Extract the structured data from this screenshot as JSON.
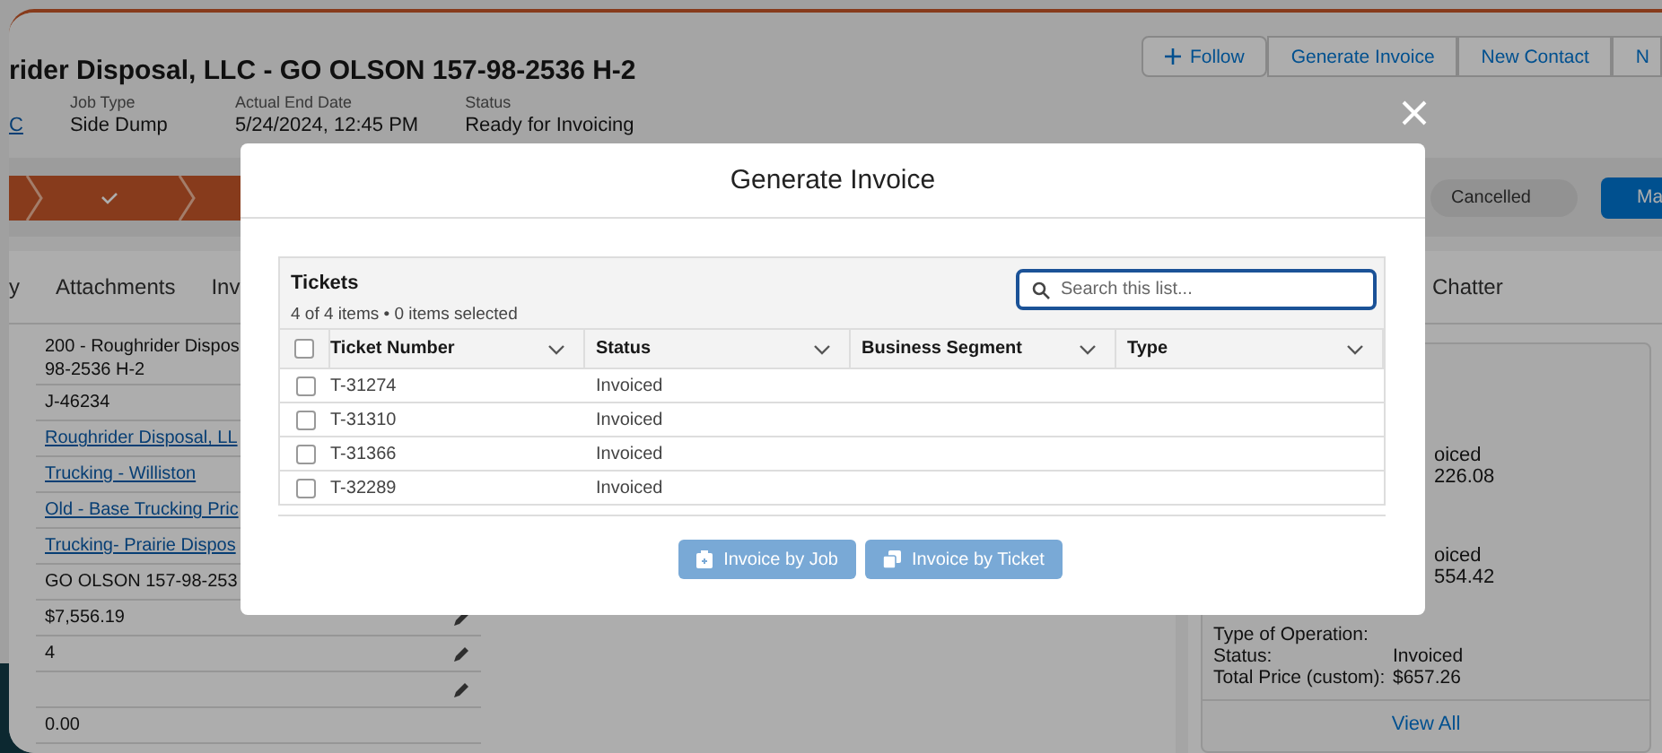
{
  "record": {
    "title": "rider Disposal, LLC - GO OLSON 157-98-2536 H-2",
    "actions": [
      {
        "label": "Follow"
      },
      {
        "label": "Generate Invoice"
      },
      {
        "label": "New Contact"
      },
      {
        "label": "N"
      }
    ]
  },
  "highlights": [
    {
      "value": "C",
      "kind": "link"
    },
    {
      "label": "Job Type",
      "value": "Side Dump",
      "kind": "text"
    },
    {
      "label": "Actual End Date",
      "value": "5/24/2024, 12:45 PM",
      "kind": "text"
    },
    {
      "label": "Status",
      "value": "Ready for Invoicing",
      "kind": "text"
    }
  ],
  "path": {
    "status_pill": "Cancelled",
    "mark_button": "Ma"
  },
  "tabs": [
    {
      "label": "y"
    },
    {
      "label": "Attachments"
    },
    {
      "label": "Inv"
    }
  ],
  "side_tabs": [
    {
      "label": "Chatter"
    }
  ],
  "details": [
    {
      "lines": [
        "200 - Roughrider Dispos",
        "98-2536 H-2"
      ],
      "kind": "text",
      "editable": false
    },
    {
      "lines": [
        "J-46234"
      ],
      "kind": "text",
      "editable": false
    },
    {
      "lines": [
        "Roughrider Disposal, LL"
      ],
      "kind": "link",
      "editable": false
    },
    {
      "lines": [
        "Trucking - Williston"
      ],
      "kind": "link",
      "editable": false
    },
    {
      "lines": [
        "Old - Base Trucking Pric"
      ],
      "kind": "link",
      "editable": false
    },
    {
      "lines": [
        "Trucking- Prairie Dispos"
      ],
      "kind": "link",
      "editable": false
    },
    {
      "lines": [
        "GO OLSON 157-98-253"
      ],
      "kind": "text",
      "editable": false
    },
    {
      "lines": [
        "$7,556.19"
      ],
      "kind": "text",
      "editable": true
    },
    {
      "lines": [
        "4"
      ],
      "kind": "text",
      "editable": true
    },
    {
      "editable": true
    },
    {
      "lines": [
        "0.00"
      ],
      "kind": "text",
      "editable": false
    }
  ],
  "related": {
    "fragments": [
      [
        "oiced",
        "226.08"
      ],
      [
        "oiced",
        "554.42"
      ]
    ],
    "fields": [
      {
        "label": "Type of Operation:"
      },
      {
        "label": "Status:",
        "value": "Invoiced"
      },
      {
        "label": "Total Price (custom):",
        "value": "$657.26"
      }
    ],
    "footer": "View All"
  },
  "modal": {
    "title": "Generate Invoice",
    "list_title": "Tickets",
    "summary": "4 of 4 items • 0 items selected",
    "search": {
      "placeholder": "Search this list..."
    },
    "all_checked": false,
    "columns": [
      "Ticket Number",
      "Status",
      "Business Segment",
      "Type"
    ],
    "rows": [
      {
        "ticket": "T-31274",
        "status": "Invoiced",
        "checked": false
      },
      {
        "ticket": "T-31310",
        "status": "Invoiced",
        "checked": false
      },
      {
        "ticket": "T-31366",
        "status": "Invoiced",
        "checked": false
      },
      {
        "ticket": "T-32289",
        "status": "Invoiced",
        "checked": false
      }
    ],
    "buttons": [
      {
        "label": "Invoice by Job",
        "disabled": true
      },
      {
        "label": "Invoice by Ticket",
        "disabled": true
      }
    ]
  }
}
